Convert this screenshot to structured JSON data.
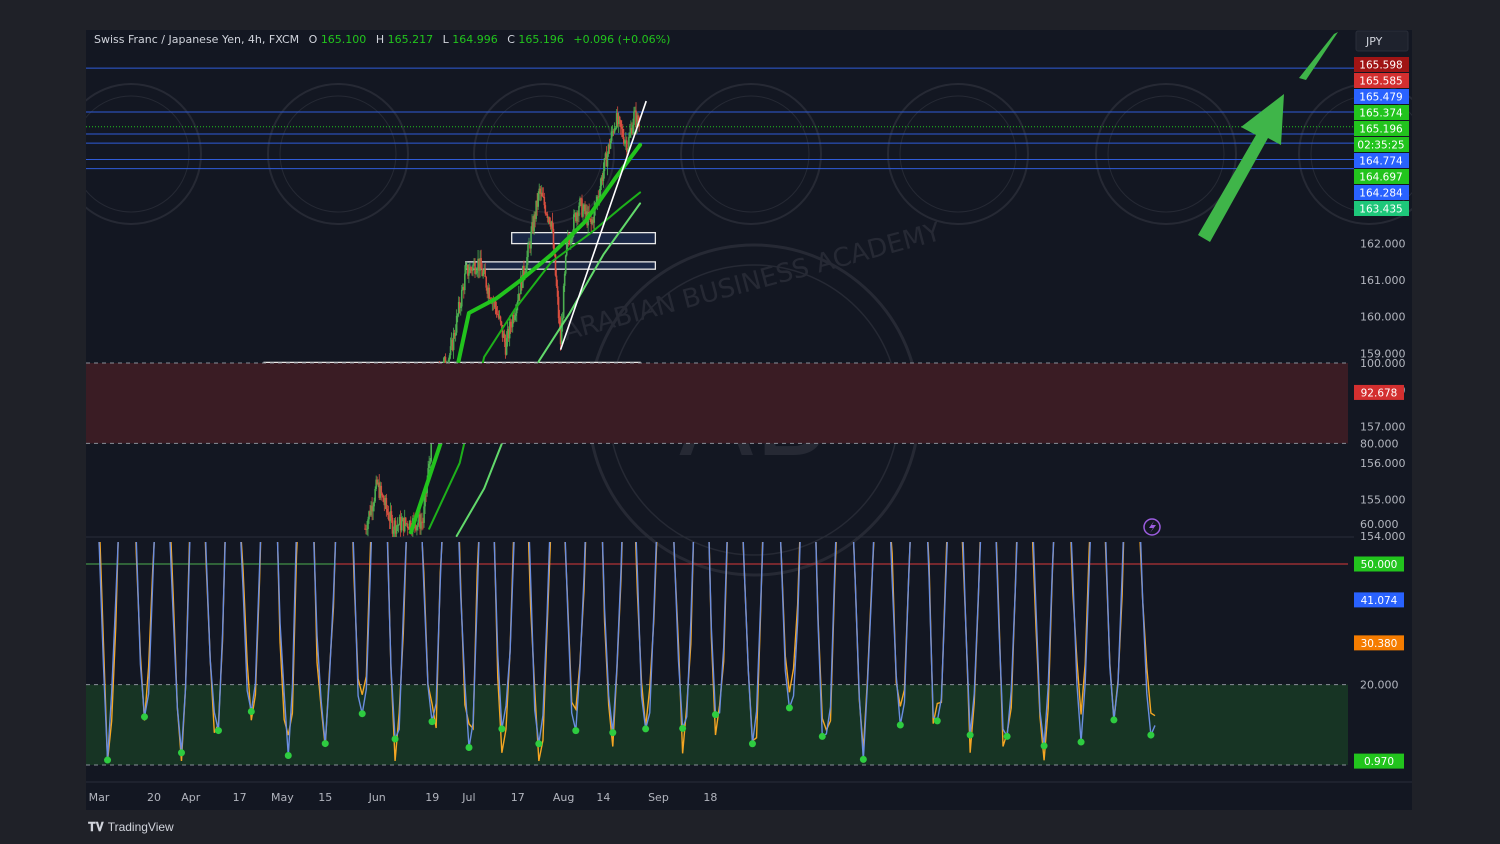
{
  "header": {
    "symbol": "Swiss Franc / Japanese Yen, 4h, FXCM",
    "open_label": "O",
    "open": "165.100",
    "high_label": "H",
    "high": "165.217",
    "low_label": "L",
    "low": "164.996",
    "close_label": "C",
    "close": "165.196",
    "change": "+0.096 (+0.06%)"
  },
  "currency_button": "JPY",
  "watermark": {
    "brand": "ARABIAN BUSINESS ACADEMY",
    "initials": "AB"
  },
  "footer": {
    "logo": "TradingView"
  },
  "colors": {
    "bull": "#4caf50",
    "bear": "#d84e3f",
    "ema_fast": "#22c41d",
    "ema_mid": "#1db01a",
    "ema_slow": "#62d96b",
    "level_line": "#2f5bd8",
    "zone_fill": "#1a2745",
    "arrow": "#3fb549",
    "osc_blue": "#6a8de0",
    "osc_orange": "#f5a623",
    "osc_midline": "#d83a3a"
  },
  "chart_data": [
    {
      "type": "candlestick",
      "title": "Swiss Franc / Japanese Yen, 4h, FXCM",
      "x_tick_labels": [
        "Mar",
        "20",
        "Apr",
        "17",
        "May",
        "15",
        "Jun",
        "19",
        "Jul",
        "17",
        "Aug",
        "14",
        "Sep",
        "18"
      ],
      "y_ticks": [
        "154.000",
        "155.000",
        "156.000",
        "157.000",
        "158.000",
        "159.000",
        "160.000",
        "161.000",
        "162.000"
      ],
      "ylim": [
        154.0,
        166.9
      ],
      "price_badges": [
        {
          "value": "165.598",
          "color": "#a01414"
        },
        {
          "value": "165.585",
          "color": "#d32f2f"
        },
        {
          "value": "165.479",
          "color": "#2962ff"
        },
        {
          "value": "165.374",
          "color": "#22c41d"
        },
        {
          "value": "165.196",
          "color": "#22c41d"
        },
        {
          "value": "02:35:25",
          "color": "#22c41d"
        },
        {
          "value": "164.774",
          "color": "#2962ff"
        },
        {
          "value": "164.697",
          "color": "#22c41d"
        },
        {
          "value": "164.284",
          "color": "#2962ff"
        },
        {
          "value": "163.435",
          "color": "#1ec77a"
        }
      ],
      "horizontal_levels": [
        166.8,
        165.6,
        165.0,
        164.75,
        164.3,
        164.05
      ],
      "zones": [
        {
          "from_date": "Apr 25",
          "to_date": "Aug 26",
          "low": 158.35,
          "high": 158.75
        },
        {
          "from_date": "Jun 30",
          "to_date": "Aug 31",
          "low": 161.3,
          "high": 161.5
        },
        {
          "from_date": "Jul 15",
          "to_date": "Aug 31",
          "low": 162.0,
          "high": 162.3
        }
      ],
      "trendline": [
        {
          "date": "Jul 31",
          "price": 159.1
        },
        {
          "date": "Aug 28",
          "price": 165.9
        }
      ],
      "path_anchors": [
        {
          "date": "May 28",
          "price": 154.2
        },
        {
          "date": "Jun 1",
          "price": 155.4
        },
        {
          "date": "Jun 6",
          "price": 154.3
        },
        {
          "date": "Jun 16",
          "price": 154.4
        },
        {
          "date": "Jun 21",
          "price": 158.4
        },
        {
          "date": "Jun 25",
          "price": 159.0
        },
        {
          "date": "Jun 30",
          "price": 161.2
        },
        {
          "date": "Jul 4",
          "price": 161.5
        },
        {
          "date": "Jul 10",
          "price": 160.2
        },
        {
          "date": "Jul 13",
          "price": 159.2
        },
        {
          "date": "Jul 20",
          "price": 161.6
        },
        {
          "date": "Jul 24",
          "price": 163.4
        },
        {
          "date": "Jul 28",
          "price": 162.6
        },
        {
          "date": "Jul 31",
          "price": 159.3
        },
        {
          "date": "Aug 2",
          "price": 161.9
        },
        {
          "date": "Aug 6",
          "price": 163.1
        },
        {
          "date": "Aug 10",
          "price": 162.5
        },
        {
          "date": "Aug 14",
          "price": 164.0
        },
        {
          "date": "Aug 18",
          "price": 165.4
        },
        {
          "date": "Aug 22",
          "price": 164.7
        },
        {
          "date": "Aug 24",
          "price": 165.5
        },
        {
          "date": "Aug 26",
          "price": 165.2
        }
      ],
      "moving_averages": [
        {
          "name": "",
          "points": [
            [
              "Jun 12",
              154.1
            ],
            [
              "Jun 22",
              156.6
            ],
            [
              "Jul 1",
              160.1
            ],
            [
              "Jul 10",
              160.5
            ],
            [
              "Jul 18",
              161.0
            ],
            [
              "Jul 28",
              161.7
            ],
            [
              "Aug 8",
              162.6
            ],
            [
              "Aug 18",
              163.8
            ],
            [
              "Aug 26",
              164.7
            ]
          ]
        },
        {
          "name": "",
          "points": [
            [
              "Jun 18",
              154.2
            ],
            [
              "Jun 28",
              156.0
            ],
            [
              "Jul 6",
              158.9
            ],
            [
              "Jul 16",
              160.2
            ],
            [
              "Jul 28",
              161.5
            ],
            [
              "Aug 10",
              162.3
            ],
            [
              "Aug 20",
              163.0
            ],
            [
              "Aug 26",
              163.4
            ]
          ]
        },
        {
          "name": "",
          "points": [
            [
              "Jun 27",
              154.0
            ],
            [
              "Jul 6",
              155.3
            ],
            [
              "Jul 14",
              157.0
            ],
            [
              "Jul 24",
              158.8
            ],
            [
              "Aug 3",
              160.1
            ],
            [
              "Aug 14",
              161.7
            ],
            [
              "Aug 26",
              163.1
            ]
          ]
        }
      ]
    },
    {
      "type": "line",
      "title": "",
      "y_ticks": [
        "20.000",
        "60.000",
        "80.000",
        "100.000"
      ],
      "ylim": [
        0,
        100
      ],
      "bands": {
        "overbought": [
          80,
          100
        ],
        "oversold": [
          0,
          20
        ],
        "midline": 50
      },
      "value_badges": [
        {
          "value": "92.678",
          "color": "#d32f2f"
        },
        {
          "value": "50.000",
          "color": "#22c41d"
        },
        {
          "value": "41.074",
          "color": "#2962ff"
        },
        {
          "value": "30.380",
          "color": "#f57c00"
        },
        {
          "value": "0.970",
          "color": "#22c41d"
        }
      ]
    }
  ]
}
